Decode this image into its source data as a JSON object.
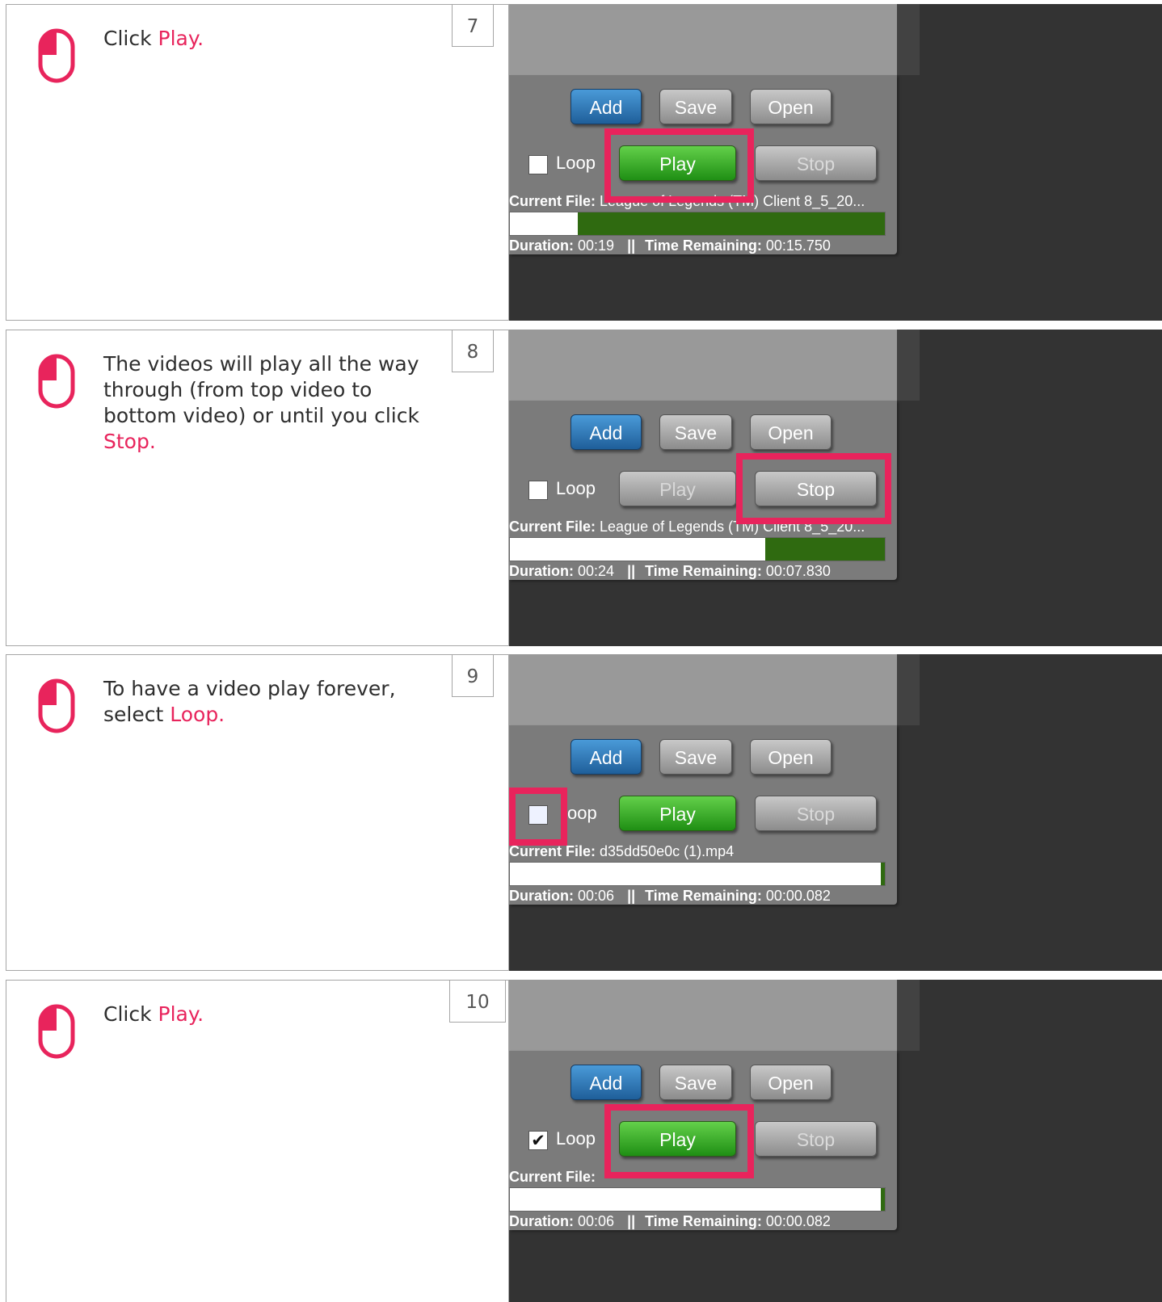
{
  "colors": {
    "highlight": "#e8245c",
    "play_green": "#3cb028",
    "add_blue": "#2a72b5",
    "progress_fill": "#2f6a10"
  },
  "steps": [
    {
      "number": "7",
      "text_before": "Click ",
      "highlight": "Play.",
      "icon": "mouse-left-click-icon",
      "screenshot": {
        "buttons": {
          "add": "Add",
          "save": "Save",
          "open": "Open",
          "play": "Play",
          "stop": "Stop"
        },
        "play_active": true,
        "stop_active": false,
        "loop_label": "Loop",
        "loop_checked": false,
        "current_file_label": "Current File:",
        "current_file": "League of Legends (TM) Client 8_5_20...",
        "progress_elapsed": 0.18,
        "duration_label": "Duration:",
        "duration": "00:19",
        "separator": "||",
        "remaining_label": "Time Remaining:",
        "remaining": "00:15.750",
        "highlighted_control": "play-button"
      }
    },
    {
      "number": "8",
      "text_before": "The videos will play all the way through (from top video to bottom video) or until you click ",
      "highlight": "Stop.",
      "icon": "mouse-left-click-icon",
      "screenshot": {
        "buttons": {
          "add": "Add",
          "save": "Save",
          "open": "Open",
          "play": "Play",
          "stop": "Stop"
        },
        "play_active": false,
        "stop_active": true,
        "loop_label": "Loop",
        "loop_checked": false,
        "current_file_label": "Current File:",
        "current_file": "League of Legends (TM) Client 8_5_20...",
        "progress_elapsed": 0.68,
        "duration_label": "Duration:",
        "duration": "00:24",
        "separator": "||",
        "remaining_label": "Time Remaining:",
        "remaining": "00:07.830",
        "highlighted_control": "stop-button"
      }
    },
    {
      "number": "9",
      "text_before": "To have a video play forever, select ",
      "highlight": "Loop.",
      "icon": "mouse-left-click-icon",
      "screenshot": {
        "buttons": {
          "add": "Add",
          "save": "Save",
          "open": "Open",
          "play": "Play",
          "stop": "Stop"
        },
        "play_active": true,
        "stop_active": false,
        "loop_label": "oop",
        "loop_checked": false,
        "current_file_label": "Current File:",
        "current_file": "d35dd50e0c (1).mp4",
        "progress_elapsed": 0.99,
        "duration_label": "Duration:",
        "duration": "00:06",
        "separator": "||",
        "remaining_label": "Time Remaining:",
        "remaining": "00:00.082",
        "highlighted_control": "loop-checkbox"
      }
    },
    {
      "number": "10",
      "text_before": "Click ",
      "highlight": "Play.",
      "icon": "mouse-left-click-icon",
      "screenshot": {
        "buttons": {
          "add": "Add",
          "save": "Save",
          "open": "Open",
          "play": "Play",
          "stop": "Stop"
        },
        "play_active": true,
        "stop_active": false,
        "loop_label": "Loop",
        "loop_checked": true,
        "check_mark": "✔",
        "current_file_label": "Current File:",
        "current_file": "",
        "progress_elapsed": 0.99,
        "duration_label": "Duration:",
        "duration": "00:06",
        "separator": "||",
        "remaining_label": "Time Remaining:",
        "remaining": "00:00.082",
        "highlighted_control": "play-button"
      }
    }
  ]
}
